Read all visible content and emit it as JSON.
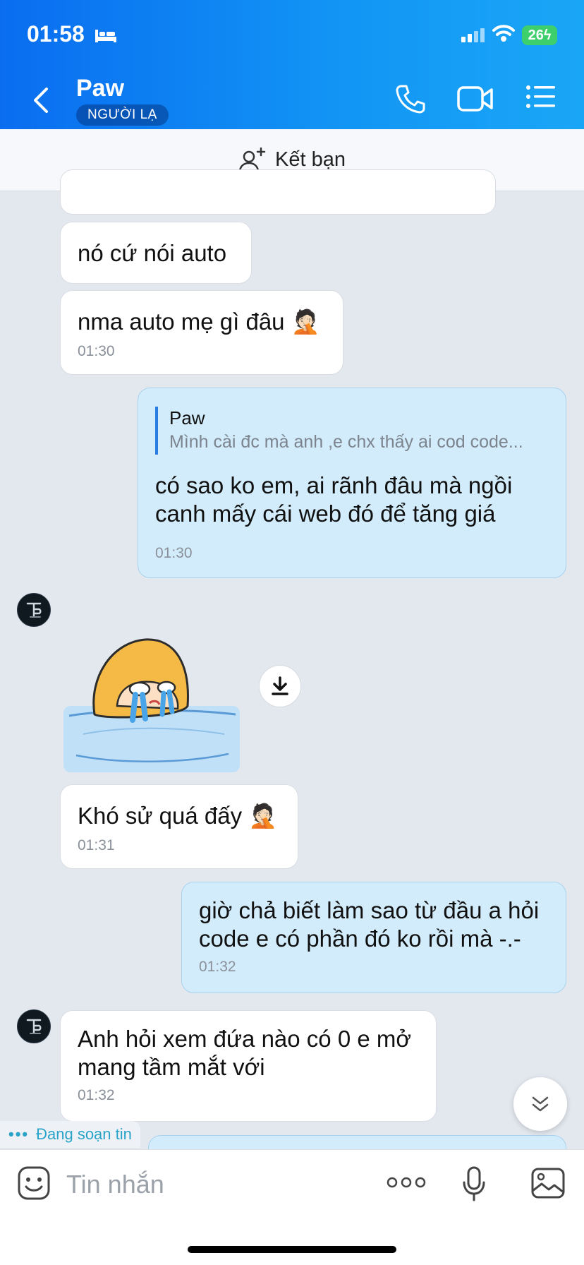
{
  "status_bar": {
    "time": "01:58",
    "battery": "26"
  },
  "header": {
    "name": "Paw",
    "badge": "NGƯỜI LẠ"
  },
  "friend_bar": {
    "label": "Kết bạn"
  },
  "messages": [
    {
      "text": "nó cứ nói auto"
    },
    {
      "text": "nma auto mẹ gì đâu 🤦🏻",
      "time": "01:30"
    },
    {
      "quote_name": "Paw",
      "quote_text": "Mình cài đc mà anh ,e chx thấy ai cod code...",
      "text": "có sao ko em, ai rãnh đâu mà ngồi canh mấy cái web đó để tăng giá",
      "time": "01:30"
    },
    {
      "text": "Khó sử quá đấy 🤦🏻",
      "time": "01:31"
    },
    {
      "text": "giờ chả biết làm sao từ đầu a hỏi code e có phần đó ko rồi mà -.-",
      "time": "01:32"
    },
    {
      "text": "Anh hỏi xem đứa nào có 0 e mở mang tầm mắt với",
      "time": "01:32"
    }
  ],
  "typing": {
    "label": "Đang soạn tin"
  },
  "input": {
    "placeholder": "Tin nhắn"
  }
}
